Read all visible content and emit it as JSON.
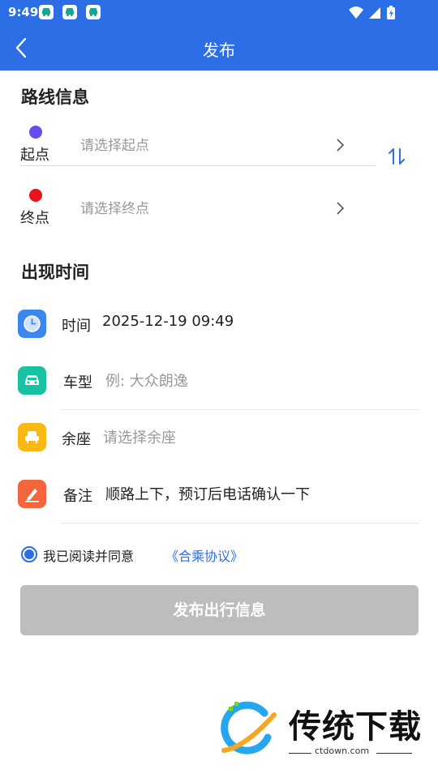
{
  "status_bar": {
    "time": "9:49"
  },
  "app_bar": {
    "title": "发布"
  },
  "route": {
    "title": "路线信息",
    "start": {
      "label": "起点",
      "placeholder": "请选择起点",
      "dot_color": "#6a4bf0"
    },
    "end": {
      "label": "终点",
      "placeholder": "请选择终点",
      "dot_color": "#e8141c"
    }
  },
  "time_section": {
    "title": "出现时间",
    "rows": [
      {
        "icon": "clock-icon",
        "label": "时间",
        "value": "2025-12-19 09:49",
        "color": "#3d86ee"
      },
      {
        "icon": "car-icon",
        "label": "车型",
        "placeholder": "例: 大众朗逸",
        "color": "#19c1a3"
      },
      {
        "icon": "seat-icon",
        "label": "余座",
        "placeholder": "请选择余座",
        "color": "#f9b914"
      },
      {
        "icon": "pencil-icon",
        "label": "备注",
        "value": "顺路上下，预订后电话确认一下",
        "color": "#f2653d"
      }
    ]
  },
  "agreement": {
    "text": "我已阅读并同意",
    "link": "《合乘协议》",
    "checked": true
  },
  "publish_button": {
    "label": "发布出行信息"
  },
  "watermark": {
    "text": "传统下载",
    "url": "ctdown.com"
  },
  "colors": {
    "accent": "#2b6ee6",
    "disabled_button": "#bdbdbd"
  }
}
